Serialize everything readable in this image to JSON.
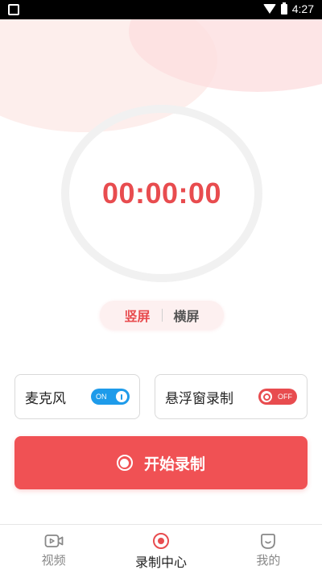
{
  "status_bar": {
    "time": "4:27"
  },
  "timer": {
    "display": "00:00:00"
  },
  "orientation": {
    "options": [
      {
        "label": "竖屏",
        "active": true
      },
      {
        "label": "横屏",
        "active": false
      }
    ]
  },
  "options": {
    "microphone": {
      "label": "麦克风",
      "toggle_text": "ON",
      "enabled": true
    },
    "floating_window": {
      "label": "悬浮窗录制",
      "toggle_text": "OFF",
      "enabled": false
    }
  },
  "record_button": {
    "label": "开始录制"
  },
  "bottom_nav": {
    "items": [
      {
        "label": "视频",
        "icon": "video-icon",
        "active": false
      },
      {
        "label": "录制中心",
        "icon": "record-icon",
        "active": true
      },
      {
        "label": "我的",
        "icon": "profile-icon",
        "active": false
      }
    ]
  },
  "colors": {
    "accent": "#e84c4f",
    "toggle_on": "#1e9bea",
    "record_button": "#f05154"
  }
}
